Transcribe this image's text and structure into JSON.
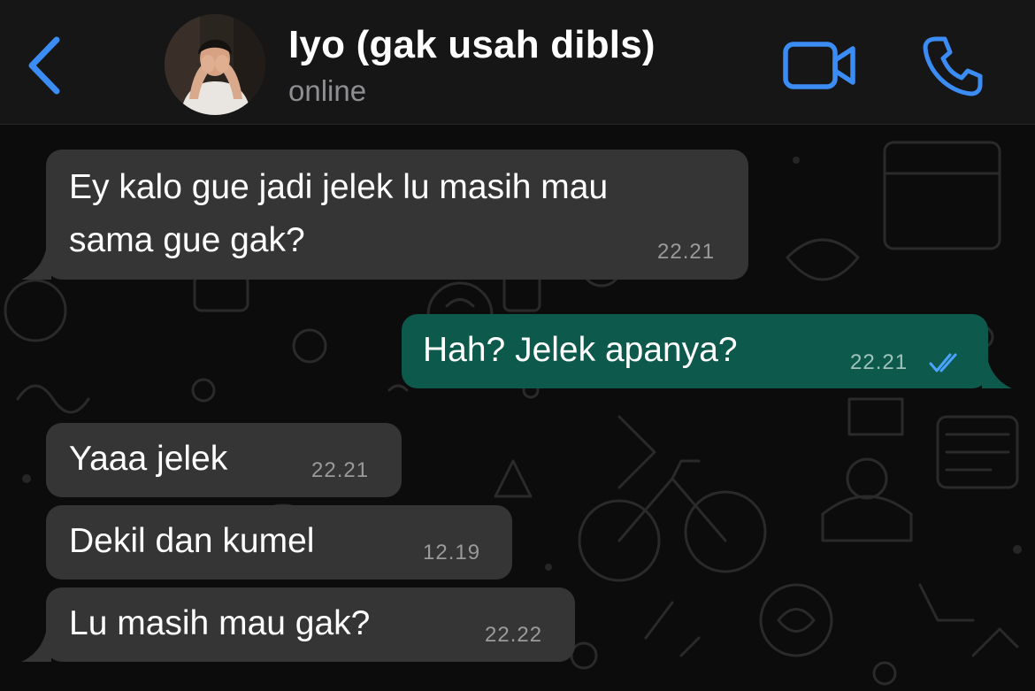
{
  "header": {
    "back_icon": "chevron-left-icon",
    "contact_name": "Iyo (gak usah dibls)",
    "status": "online",
    "video_icon": "video-camera-icon",
    "call_icon": "phone-icon",
    "accent_color": "#3b8df5"
  },
  "messages": [
    {
      "direction": "incoming",
      "lines": [
        "Ey kalo gue jadi jelek lu masih mau",
        "sama gue gak?"
      ],
      "time": "22.21"
    },
    {
      "direction": "outgoing",
      "lines": [
        "Hah? Jelek apanya?"
      ],
      "time": "22.21",
      "receipt": "double-check-read-icon"
    },
    {
      "direction": "incoming",
      "lines": [
        "Yaaa jelek"
      ],
      "time": "22.21"
    },
    {
      "direction": "incoming",
      "lines": [
        "Dekil dan kumel"
      ],
      "time": "12.19"
    },
    {
      "direction": "incoming",
      "lines": [
        "Lu masih mau gak?"
      ],
      "time": "22.22"
    }
  ],
  "colors": {
    "incoming_bubble": "#353535",
    "outgoing_bubble": "#0d5a4d",
    "header_background": "#161616",
    "chat_background": "#0c0c0c"
  }
}
